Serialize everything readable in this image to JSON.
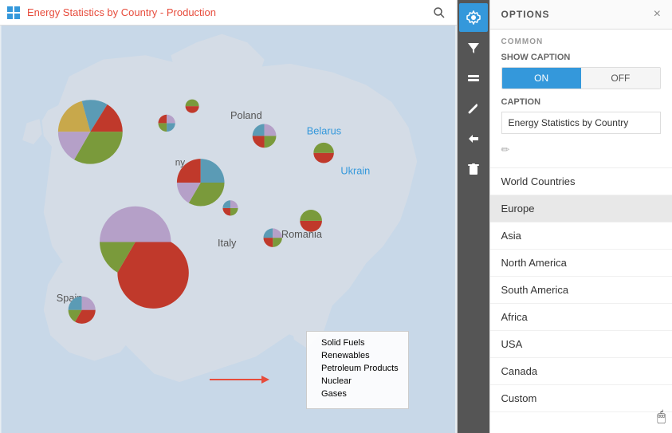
{
  "header": {
    "title": "Energy Statistics by Country",
    "subtitle": "Production",
    "separator": " - "
  },
  "toolbar": {
    "buttons": [
      {
        "id": "grid",
        "label": "grid-icon",
        "active": false
      },
      {
        "id": "filter",
        "label": "filter-icon",
        "active": false
      },
      {
        "id": "layers",
        "label": "layers-icon",
        "active": true
      },
      {
        "id": "wrench",
        "label": "wrench-icon",
        "active": false
      },
      {
        "id": "arrow",
        "label": "arrow-icon",
        "active": false
      },
      {
        "id": "trash",
        "label": "trash-icon",
        "active": false
      }
    ]
  },
  "options": {
    "title": "OPTIONS",
    "close_label": "×",
    "section_common": "COMMON",
    "show_caption_label": "SHOW CAPTION",
    "toggle_on": "ON",
    "toggle_off": "OFF",
    "caption_label": "CAPTION",
    "caption_value": "Energy Statistics by Country",
    "countries": [
      {
        "id": "world",
        "label": "World Countries",
        "selected": false
      },
      {
        "id": "europe",
        "label": "Europe",
        "selected": true
      },
      {
        "id": "asia",
        "label": "Asia",
        "selected": false
      },
      {
        "id": "north-america",
        "label": "North America",
        "selected": false
      },
      {
        "id": "south-america",
        "label": "South America",
        "selected": false
      },
      {
        "id": "africa",
        "label": "Africa",
        "selected": false
      },
      {
        "id": "usa",
        "label": "USA",
        "selected": false
      },
      {
        "id": "canada",
        "label": "Canada",
        "selected": false
      },
      {
        "id": "custom",
        "label": "Custom",
        "selected": false
      }
    ]
  },
  "legend": {
    "items": [
      {
        "label": "Solid Fuels",
        "color": "#7a9a3b"
      },
      {
        "label": "Renewables",
        "color": "#b5a0c8"
      },
      {
        "label": "Petroleum Products",
        "color": "#c8a84b"
      },
      {
        "label": "Nuclear",
        "color": "#c0392b"
      },
      {
        "label": "Gases",
        "color": "#5b9bb5"
      }
    ]
  },
  "labels": {
    "belarus": "Belarus",
    "ukraine": "Ukrain",
    "italy": "Italy",
    "spain": "Spain",
    "romania": "Romania",
    "poland": "Poland",
    "germany_abbr": "ny"
  },
  "icons": {
    "grid": "⊞",
    "search": "🔍",
    "close": "✕",
    "pencil": "✏",
    "filter": "▽",
    "layers": "⧉",
    "wrench": "⚙",
    "arrow": "⇄",
    "trash": "🗑"
  }
}
